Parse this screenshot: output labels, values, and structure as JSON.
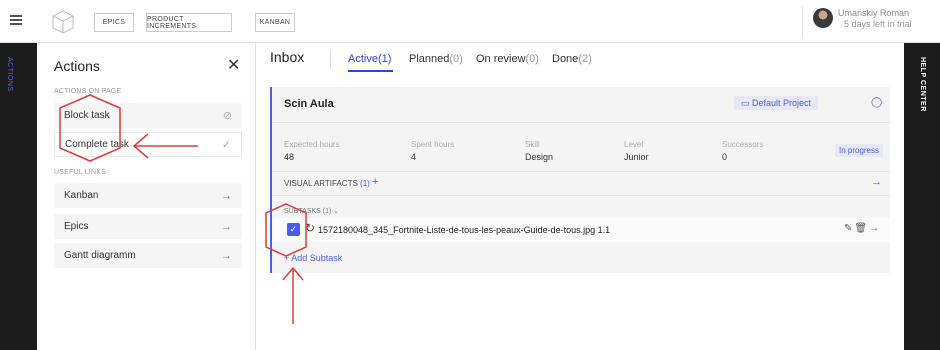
{
  "topbar": {
    "nav": [
      "EPICS",
      "PRODUCT INCREMENTS",
      "KANBAN"
    ],
    "user_name": "Umanskiy Roman",
    "trial": "5 days left in trial"
  },
  "leftbar": {
    "label": "ACTIONS"
  },
  "rightbar": {
    "label": "HELP CENTER"
  },
  "panel": {
    "title": "Actions",
    "close": "✕",
    "section_page": "ACTIONS ON PAGE",
    "block_task": "Block task",
    "complete_task": "Complete task",
    "section_links": "USEFUL LINKS",
    "links": [
      "Kanban",
      "Epics",
      "Gantt diagramm"
    ]
  },
  "main": {
    "inbox": "Inbox",
    "tabs": [
      {
        "label": "Active",
        "count": "(1)"
      },
      {
        "label": "Planned",
        "count": "(0)"
      },
      {
        "label": "On review",
        "count": "(0)"
      },
      {
        "label": "Done",
        "count": "(2)"
      }
    ]
  },
  "card": {
    "title": "Scin Aula",
    "project": "Default Project",
    "fields": [
      {
        "label": "Expected hours",
        "value": "48"
      },
      {
        "label": "Spent hours",
        "value": "4"
      },
      {
        "label": "Skill",
        "value": "Design"
      },
      {
        "label": "Level",
        "value": "Junior"
      },
      {
        "label": "Successors",
        "value": "0"
      }
    ],
    "status": "In progress",
    "visual_artifacts": "VISUAL ARTIFACTS",
    "visual_artifacts_count": "(1)",
    "subtasks": "SUBTASKS (1)",
    "subtask_name": "1572180048_345_Fortnite-Liste-de-tous-les-peaux-Guide-de-tous.jpg 1.1",
    "add_subtask": "+ Add Subtask"
  },
  "annotation_color": "#e53935"
}
